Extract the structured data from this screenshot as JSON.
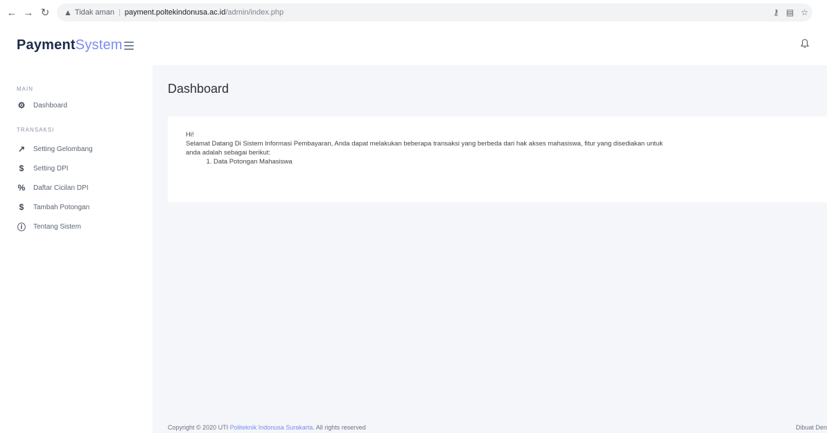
{
  "browser": {
    "not_secure": "Tidak aman",
    "url_host": "payment.poltekindonusa.ac.id",
    "url_path": "/admin/index.php"
  },
  "app": {
    "brand_strong": "Payment",
    "brand_light": "System",
    "accent_color": "#7b8cf0"
  },
  "sidebar": {
    "section_main": "MAIN",
    "dashboard": "Dashboard",
    "section_transaksi": "TRANSAKSI",
    "items": [
      {
        "label": "Setting Gelombang",
        "icon": "chart-line-icon"
      },
      {
        "label": "Setting DPI",
        "icon": "dollar-icon"
      },
      {
        "label": "Daftar Cicilan DPI",
        "icon": "percent-icon"
      },
      {
        "label": "Tambah Potongan",
        "icon": "dollar-icon"
      },
      {
        "label": "Tentang Sistem",
        "icon": "info-icon"
      }
    ]
  },
  "main": {
    "title": "Dashboard",
    "greeting": "Hi!",
    "line1": "Selamat Datang Di Sistem Informasi Pembayaran, Anda dapat melakukan beberapa transaksi yang berbeda dari hak akses mahasiswa, fitur yang disediakan untuk",
    "line2": "anda adalah sebagai berikut:",
    "list_item": "Data Potongan Mahasiswa"
  },
  "footer": {
    "copyright_prefix": "Copyright © 2020 UTI ",
    "institution": "Politeknik Indonusa Surakarta",
    "copyright_suffix": ". All rights reserved",
    "right_text": "Dibuat Den"
  }
}
